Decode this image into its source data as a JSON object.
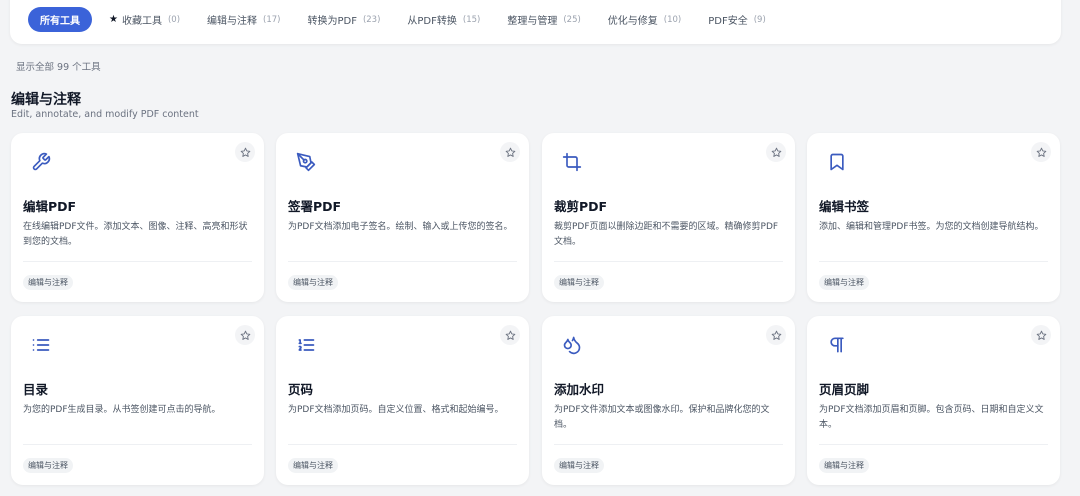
{
  "tabs": [
    {
      "label": "所有工具",
      "count": ""
    },
    {
      "label": "收藏工具",
      "count": "(0)"
    },
    {
      "label": "编辑与注释",
      "count": "(17)"
    },
    {
      "label": "转换为PDF",
      "count": "(23)"
    },
    {
      "label": "从PDF转换",
      "count": "(15)"
    },
    {
      "label": "整理与管理",
      "count": "(25)"
    },
    {
      "label": "优化与修复",
      "count": "(10)"
    },
    {
      "label": "PDF安全",
      "count": "(9)"
    }
  ],
  "tool_count_text": "显示全部 99 个工具",
  "section": {
    "title": "编辑与注释",
    "subtitle": "Edit, annotate, and modify PDF content"
  },
  "cards": [
    {
      "icon": "wrench-icon",
      "title": "编辑PDF",
      "desc": "在线编辑PDF文件。添加文本、图像、注释、高亮和形状到您的文档。",
      "tag": "编辑与注释"
    },
    {
      "icon": "pen-nib-icon",
      "title": "签署PDF",
      "desc": "为PDF文档添加电子签名。绘制、输入或上传您的签名。",
      "tag": "编辑与注释"
    },
    {
      "icon": "crop-icon",
      "title": "裁剪PDF",
      "desc": "裁剪PDF页面以删除边距和不需要的区域。精确修剪PDF文档。",
      "tag": "编辑与注释"
    },
    {
      "icon": "bookmark-icon",
      "title": "编辑书签",
      "desc": "添加、编辑和管理PDF书签。为您的文档创建导航结构。",
      "tag": "编辑与注释"
    },
    {
      "icon": "list-icon",
      "title": "目录",
      "desc": "为您的PDF生成目录。从书签创建可点击的导航。",
      "tag": "编辑与注释"
    },
    {
      "icon": "numbered-list-icon",
      "title": "页码",
      "desc": "为PDF文档添加页码。自定义位置、格式和起始编号。",
      "tag": "编辑与注释"
    },
    {
      "icon": "droplets-icon",
      "title": "添加水印",
      "desc": "为PDF文件添加文本或图像水印。保护和品牌化您的文档。",
      "tag": "编辑与注释"
    },
    {
      "icon": "pilcrow-icon",
      "title": "页眉页脚",
      "desc": "为PDF文档添加页眉和页脚。包含页码、日期和自定义文本。",
      "tag": "编辑与注释"
    }
  ],
  "colors": {
    "accent": "#3b63d9",
    "icon": "#3b5bbf",
    "background": "#f3f4f6"
  }
}
